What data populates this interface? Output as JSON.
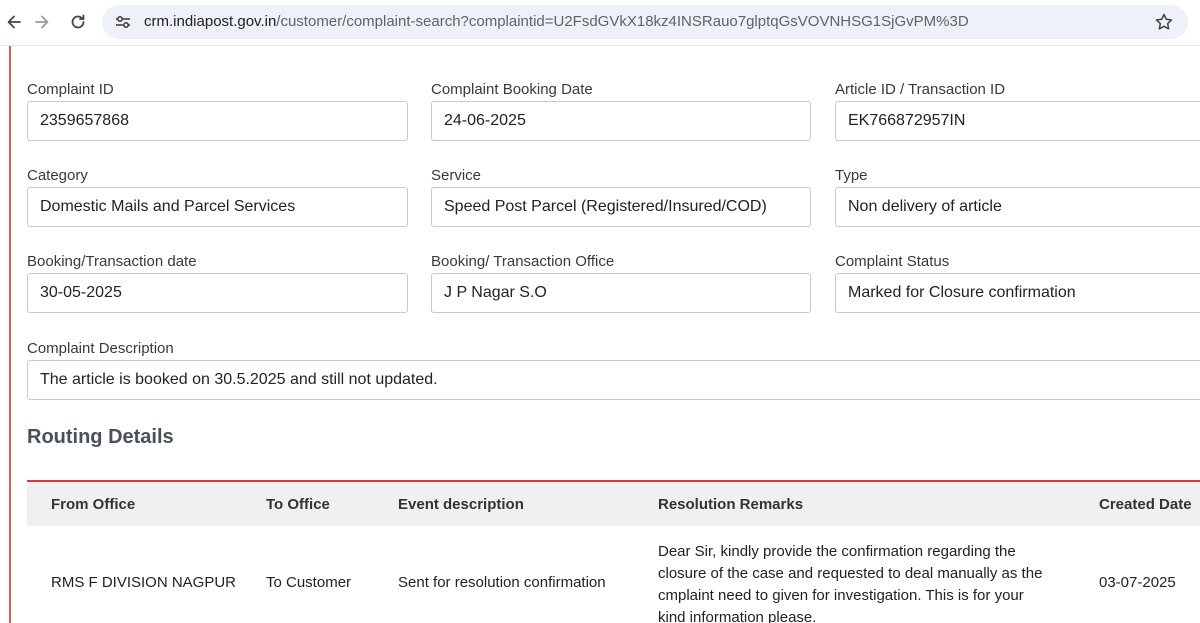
{
  "browser": {
    "url_host": "crm.indiapost.gov.in",
    "url_path": "/customer/complaint-search?complaintid=U2FsdGVkX18kz4INSRauo7glptqGsVOVNHSG1SjGvPM%3D"
  },
  "fields": {
    "complaint_id": {
      "label": "Complaint ID",
      "value": "2359657868"
    },
    "booking_date": {
      "label": "Complaint Booking Date",
      "value": "24-06-2025"
    },
    "article_id": {
      "label": "Article ID / Transaction ID",
      "value": "EK766872957IN"
    },
    "category": {
      "label": "Category",
      "value": "Domestic Mails and Parcel Services"
    },
    "service": {
      "label": "Service",
      "value": "Speed Post Parcel (Registered/Insured/COD)"
    },
    "type": {
      "label": "Type",
      "value": "Non delivery of article"
    },
    "transaction_date": {
      "label": "Booking/Transaction date",
      "value": "30-05-2025"
    },
    "transaction_office": {
      "label": "Booking/ Transaction Office",
      "value": "J P Nagar S.O"
    },
    "status": {
      "label": "Complaint Status",
      "value": "Marked for Closure confirmation"
    },
    "description": {
      "label": "Complaint Description",
      "value": "The article is booked on 30.5.2025 and still not updated."
    }
  },
  "routing": {
    "title": "Routing Details",
    "columns": [
      "From Office",
      "To Office",
      "Event description",
      "Resolution Remarks",
      "Created Date"
    ],
    "rows": [
      {
        "from_office": "RMS F DIVISION NAGPUR",
        "to_office": "To Customer",
        "event": "Sent for resolution confirmation",
        "remarks": "Dear Sir, kindly provide the confirmation regarding the closure of the case and requested to deal manually as the cmplaint need to given for investigation. This is for your kind information please.",
        "created_date": "03-07-2025"
      }
    ]
  }
}
